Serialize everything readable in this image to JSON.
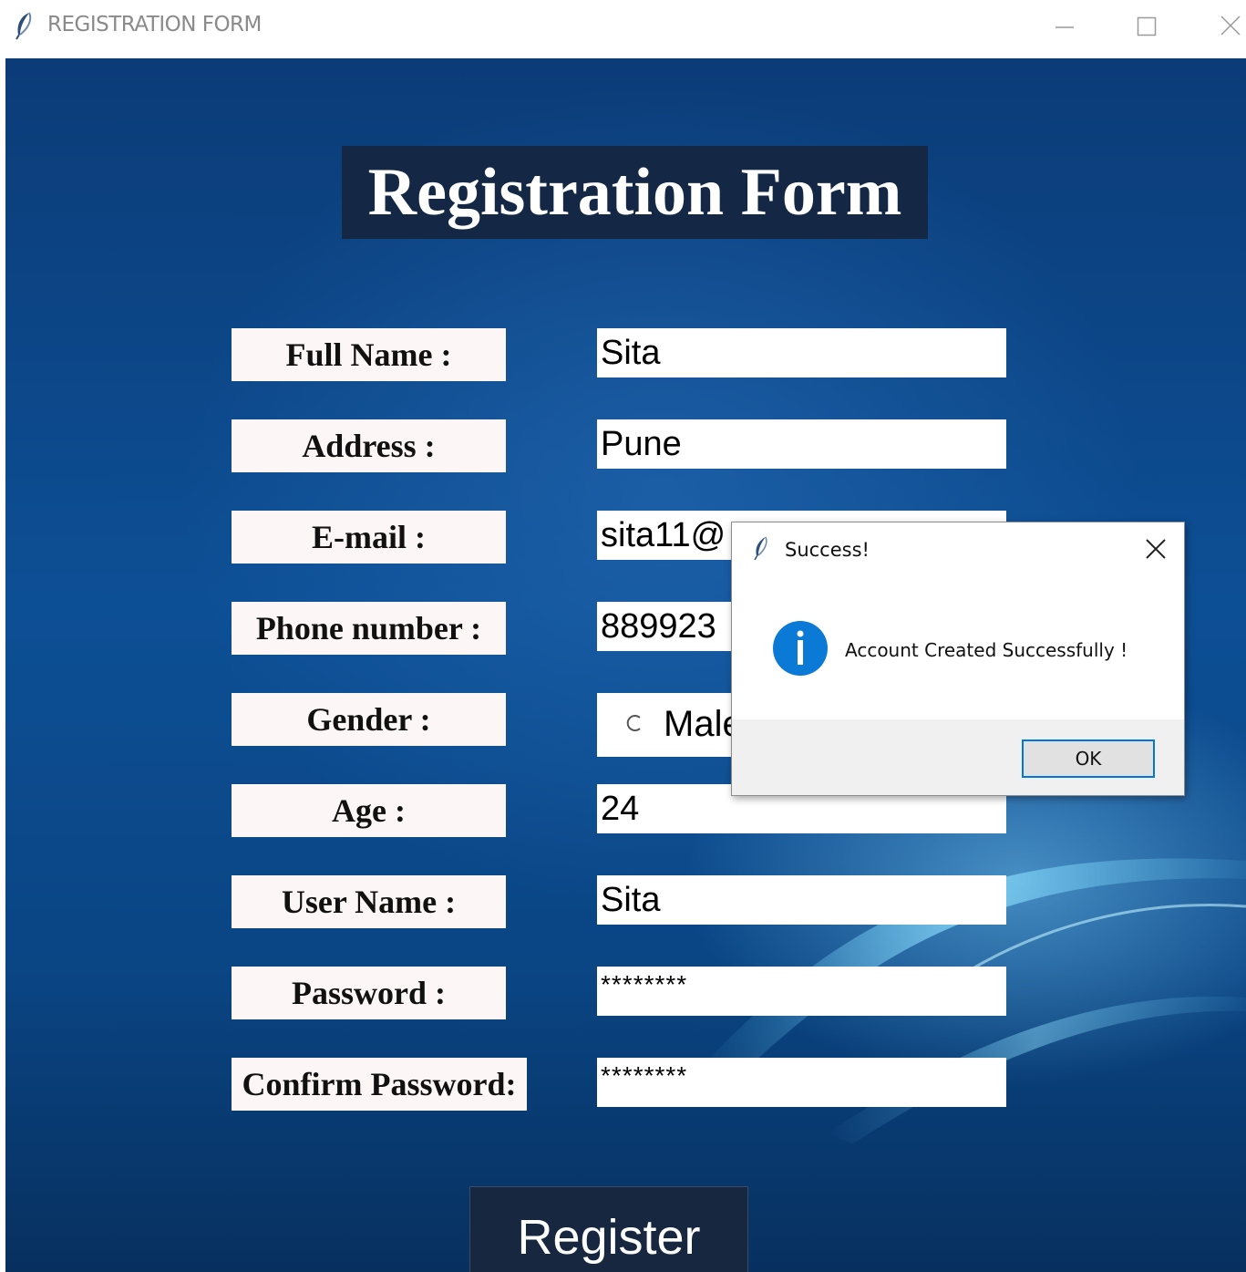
{
  "window": {
    "title": "REGISTRATION FORM",
    "icon": "feather-icon"
  },
  "form": {
    "title": "Registration Form",
    "fields": [
      {
        "label": "Full Name :",
        "value": "Sita"
      },
      {
        "label": "Address :",
        "value": "Pune"
      },
      {
        "label": "E-mail :",
        "value": "sita11@"
      },
      {
        "label": "Phone number :",
        "value": "889923"
      },
      {
        "label": "Gender :",
        "option": "Male"
      },
      {
        "label": "Age :",
        "value": "24"
      },
      {
        "label": "User Name :",
        "value": "Sita"
      },
      {
        "label": "Password :",
        "value": "********"
      },
      {
        "label": "Confirm Password:",
        "value": "********"
      }
    ],
    "register_label": "Register"
  },
  "dialog": {
    "title": "Success!",
    "icon": "info-icon",
    "message": "Account Created Successfully !",
    "ok_label": "OK"
  },
  "colors": {
    "background": "#0d4f95",
    "title_bg": "#142845",
    "label_bg": "#fdf6f6",
    "dialog_accent": "#0078d7",
    "info_icon": "#0a7ad6"
  }
}
